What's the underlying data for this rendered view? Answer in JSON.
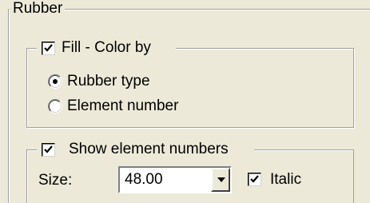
{
  "rubber_group": {
    "title": "Rubber"
  },
  "fill_group": {
    "checkbox_label": "Fill - Color by",
    "checked": true,
    "options": [
      {
        "label": "Rubber type",
        "selected": true
      },
      {
        "label": "Element number",
        "selected": false
      }
    ]
  },
  "element_numbers_group": {
    "checkbox_label": "Show element numbers",
    "checked": true,
    "size_label": "Size:",
    "size_value": "48.00",
    "italic_label": "Italic",
    "italic_checked": true
  }
}
